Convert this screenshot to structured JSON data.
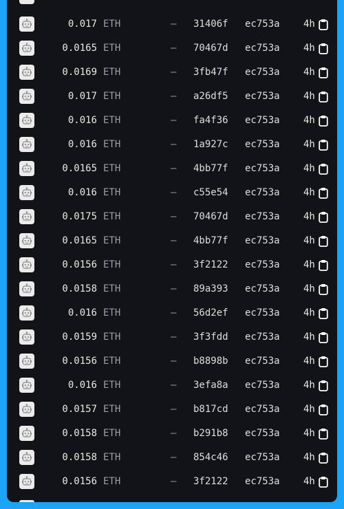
{
  "table": {
    "rows": [
      {
        "price": "0.017",
        "unit": "ETH",
        "dash": "–",
        "from": "31406f",
        "to": "ec753a",
        "age": "4h"
      },
      {
        "price": "0.0165",
        "unit": "ETH",
        "dash": "–",
        "from": "70467d",
        "to": "ec753a",
        "age": "4h"
      },
      {
        "price": "0.0169",
        "unit": "ETH",
        "dash": "–",
        "from": "3fb47f",
        "to": "ec753a",
        "age": "4h"
      },
      {
        "price": "0.017",
        "unit": "ETH",
        "dash": "–",
        "from": "a26df5",
        "to": "ec753a",
        "age": "4h"
      },
      {
        "price": "0.016",
        "unit": "ETH",
        "dash": "–",
        "from": "fa4f36",
        "to": "ec753a",
        "age": "4h"
      },
      {
        "price": "0.016",
        "unit": "ETH",
        "dash": "–",
        "from": "1a927c",
        "to": "ec753a",
        "age": "4h"
      },
      {
        "price": "0.0165",
        "unit": "ETH",
        "dash": "–",
        "from": "4bb77f",
        "to": "ec753a",
        "age": "4h"
      },
      {
        "price": "0.016",
        "unit": "ETH",
        "dash": "–",
        "from": "c55e54",
        "to": "ec753a",
        "age": "4h"
      },
      {
        "price": "0.0175",
        "unit": "ETH",
        "dash": "–",
        "from": "70467d",
        "to": "ec753a",
        "age": "4h"
      },
      {
        "price": "0.0165",
        "unit": "ETH",
        "dash": "–",
        "from": "4bb77f",
        "to": "ec753a",
        "age": "4h"
      },
      {
        "price": "0.0156",
        "unit": "ETH",
        "dash": "–",
        "from": "3f2122",
        "to": "ec753a",
        "age": "4h"
      },
      {
        "price": "0.0158",
        "unit": "ETH",
        "dash": "–",
        "from": "89a393",
        "to": "ec753a",
        "age": "4h"
      },
      {
        "price": "0.016",
        "unit": "ETH",
        "dash": "–",
        "from": "56d2ef",
        "to": "ec753a",
        "age": "4h"
      },
      {
        "price": "0.0159",
        "unit": "ETH",
        "dash": "–",
        "from": "3f3fdd",
        "to": "ec753a",
        "age": "4h"
      },
      {
        "price": "0.0156",
        "unit": "ETH",
        "dash": "–",
        "from": "b8898b",
        "to": "ec753a",
        "age": "4h"
      },
      {
        "price": "0.016",
        "unit": "ETH",
        "dash": "–",
        "from": "3efa8a",
        "to": "ec753a",
        "age": "4h"
      },
      {
        "price": "0.0157",
        "unit": "ETH",
        "dash": "–",
        "from": "b817cd",
        "to": "ec753a",
        "age": "4h"
      },
      {
        "price": "0.0158",
        "unit": "ETH",
        "dash": "–",
        "from": "b291b8",
        "to": "ec753a",
        "age": "4h"
      },
      {
        "price": "0.0158",
        "unit": "ETH",
        "dash": "–",
        "from": "854c46",
        "to": "ec753a",
        "age": "4h"
      },
      {
        "price": "0.0156",
        "unit": "ETH",
        "dash": "–",
        "from": "3f2122",
        "to": "ec753a",
        "age": "4h"
      }
    ]
  },
  "icons": {
    "avatar": "robot-avatar-icon",
    "copy": "clipboard-copy-icon"
  },
  "colors": {
    "page_background": "#1ba4f5",
    "panel_background": "#121317",
    "avatar_background": "#ecebea"
  }
}
